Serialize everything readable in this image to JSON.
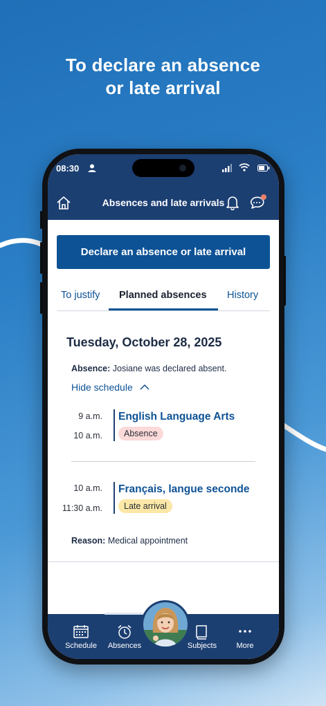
{
  "headline": {
    "line1": "To declare an absence",
    "line2": "or late arrival"
  },
  "status_bar": {
    "time": "08:30"
  },
  "app_bar": {
    "title": "Absences and late arrivals",
    "home_icon": "home-icon",
    "bell_icon": "bell-icon",
    "chat_icon": "chat-icon",
    "notification_dot_color": "#e8806a"
  },
  "declare_button": {
    "label": "Declare an absence or late arrival"
  },
  "tabs": [
    {
      "label": "To justify",
      "active": false
    },
    {
      "label": "Planned absences",
      "active": true
    },
    {
      "label": "History",
      "active": false
    }
  ],
  "entry": {
    "date": "Tuesday, October 28, 2025",
    "absence_label": "Absence:",
    "absence_text": "Josiane was declared absent.",
    "toggle_label": "Hide schedule",
    "periods": [
      {
        "start": "9 a.m.",
        "end": "10 a.m.",
        "course": "English Language Arts",
        "status": "Absence",
        "status_color": "#fbdad9"
      },
      {
        "start": "10 a.m.",
        "end": "11:30 a.m.",
        "course": "Français, langue seconde",
        "status": "Late arrival",
        "status_color": "#fbe7a6"
      }
    ],
    "reason_label": "Reason:",
    "reason_text": "Medical appointment"
  },
  "bottom_nav": [
    {
      "label": "Schedule",
      "icon": "calendar-icon"
    },
    {
      "label": "Absences",
      "icon": "alarm-clock-icon",
      "active": true
    },
    {
      "label": "Subjects",
      "icon": "book-icon"
    },
    {
      "label": "More",
      "icon": "more-dots-icon"
    }
  ],
  "colors": {
    "primary_dark": "#1c3f72",
    "primary": "#0d5295",
    "accent_text": "#1d2b45"
  }
}
